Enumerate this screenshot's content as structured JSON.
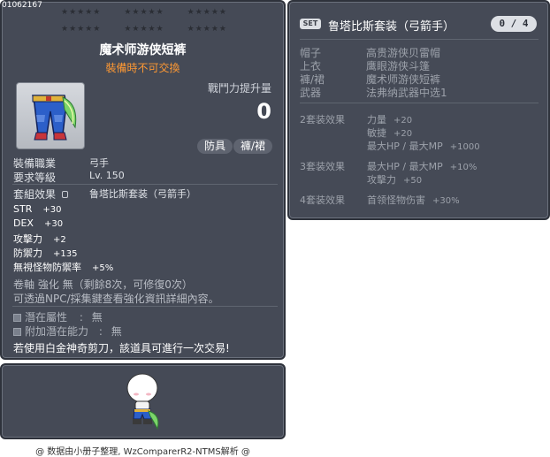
{
  "item_id": "01062167",
  "stars": {
    "row1": [
      "★★★★★",
      "★★★★★",
      "★★★★★"
    ],
    "row2": [
      "★★★★★",
      "★★★★★",
      "★★★★★"
    ]
  },
  "item": {
    "name": "魔术师游侠短裤",
    "trade_status": "裝備時不可交換",
    "combat_power_label": "戰鬥力提升量",
    "combat_power_value": "0",
    "tags": [
      "防具",
      "褲/裙"
    ],
    "requirements": [
      {
        "label": "裝備職業",
        "value": "弓手"
      },
      {
        "label": "要求等級",
        "value": "Lv. 150"
      }
    ],
    "set_effect_label": "套組效果",
    "set_effect_value": "鲁塔比斯套装（弓箭手）",
    "stats": [
      {
        "label": "STR",
        "value": "+30"
      },
      {
        "label": "DEX",
        "value": "+30"
      },
      {
        "label": "攻擊力",
        "value": "+2"
      },
      {
        "label": "防禦力",
        "value": "+135"
      },
      {
        "label": "無視怪物防禦率",
        "value": "+5%"
      }
    ],
    "scroll_info": "卷軸 強化 無（剩餘8次，可修復0次）",
    "npc_info": "可透過NPC/採集鍵查看強化資訊詳細內容。",
    "potential": {
      "label": "潛在屬性",
      "value": "無"
    },
    "additional_potential": {
      "label": "附加潛在能力",
      "value": "無"
    },
    "trade_note": "若使用白金神奇剪刀，該道具可進行一次交易!"
  },
  "set": {
    "badge": "SET",
    "title": "鲁塔比斯套装（弓箭手）",
    "count": "0 / 4",
    "pieces": [
      {
        "slot": "帽子",
        "name": "高贵游侠贝雷帽"
      },
      {
        "slot": "上衣",
        "name": "鹰眼游侠斗篷"
      },
      {
        "slot": "褲/裙",
        "name": "魔术师游侠短裤"
      },
      {
        "slot": "武器",
        "name": "法弗纳武器中选1"
      }
    ],
    "bonuses": [
      {
        "label": "2套装效果",
        "effects": [
          {
            "stat": "力量",
            "value": "+20"
          },
          {
            "stat": "敏捷",
            "value": "+20"
          },
          {
            "stat": "最大HP / 最大MP",
            "value": "+1000"
          }
        ]
      },
      {
        "label": "3套装效果",
        "effects": [
          {
            "stat": "最大HP / 最大MP",
            "value": "+10%"
          },
          {
            "stat": "攻擊力",
            "value": "+50"
          }
        ]
      },
      {
        "label": "4套装效果",
        "effects": [
          {
            "stat": "首领怪物伤害",
            "value": "+30%"
          }
        ]
      }
    ]
  },
  "footer": "@ 数据由小册子整理, WzComparerR2-NTMS解析 @",
  "colors": {
    "panel_bg": "#454a56",
    "trade_orange": "#ff9933",
    "text_dim": "#9ca1aa"
  },
  "icons": [
    "pants-item-icon",
    "lock-icon",
    "character-preview"
  ]
}
